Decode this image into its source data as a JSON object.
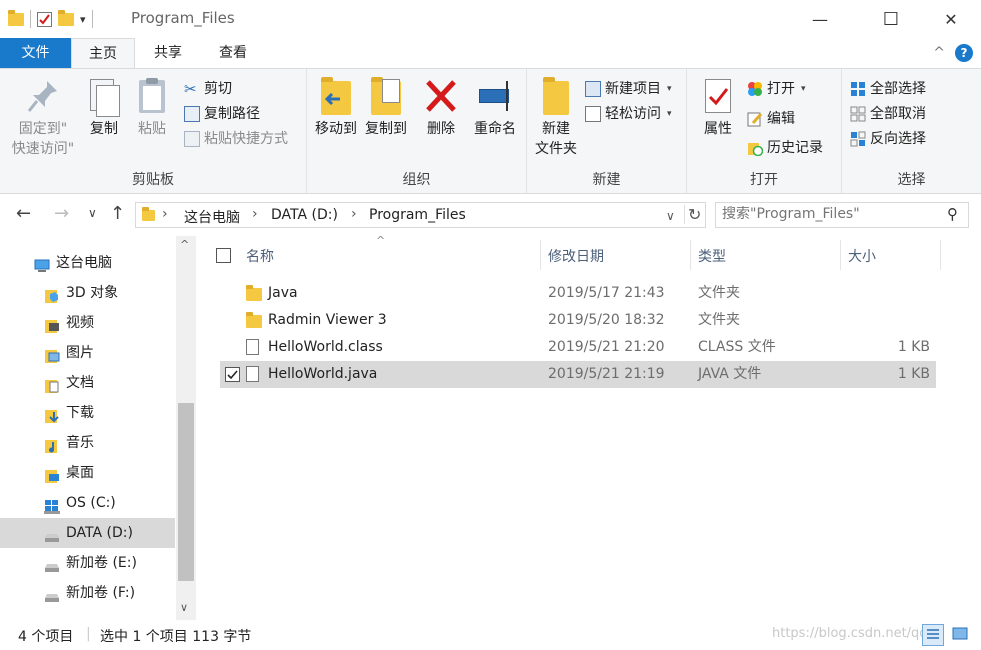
{
  "window": {
    "title": "Program_Files",
    "qat_caret": "▾",
    "minimize": "—",
    "maximize": "☐",
    "close": "✕",
    "collapse_ribbon": "^",
    "help": "?"
  },
  "tabs": [
    {
      "label": "文件"
    },
    {
      "label": "主页"
    },
    {
      "label": "共享"
    },
    {
      "label": "查看"
    }
  ],
  "ribbon": {
    "clipboard": {
      "label": "剪贴板",
      "pin_line1": "固定到\"",
      "pin_line2": "快速访问\"",
      "copy": "复制",
      "paste": "粘贴",
      "cut": "剪切",
      "copy_path": "复制路径",
      "paste_shortcut": "粘贴快捷方式"
    },
    "organize": {
      "label": "组织",
      "move_to": "移动到",
      "copy_to": "复制到",
      "delete": "删除",
      "rename": "重命名"
    },
    "new": {
      "label": "新建",
      "new_folder_line1": "新建",
      "new_folder_line2": "文件夹",
      "new_item": "新建项目",
      "easy_access": "轻松访问"
    },
    "open": {
      "label": "打开",
      "properties": "属性",
      "open": "打开",
      "edit": "编辑",
      "history": "历史记录"
    },
    "select": {
      "label": "选择",
      "select_all": "全部选择",
      "select_none": "全部取消",
      "invert": "反向选择"
    }
  },
  "address": {
    "back": "←",
    "forward": "→",
    "recent": "∨",
    "up": "↑",
    "crumbs": [
      "这台电脑",
      "DATA (D:)",
      "Program_Files"
    ],
    "sep": "›",
    "dropdown": "∨",
    "refresh": "↻"
  },
  "search": {
    "placeholder": "搜索\"Program_Files\"",
    "icon_glyph": "⚲"
  },
  "nav": {
    "items": [
      {
        "label": "这台电脑"
      },
      {
        "label": "3D 对象"
      },
      {
        "label": "视频"
      },
      {
        "label": "图片"
      },
      {
        "label": "文档"
      },
      {
        "label": "下载"
      },
      {
        "label": "音乐"
      },
      {
        "label": "桌面"
      },
      {
        "label": "OS (C:)"
      },
      {
        "label": "DATA (D:)"
      },
      {
        "label": "新加卷 (E:)"
      },
      {
        "label": "新加卷 (F:)"
      }
    ],
    "scroll_up": "^",
    "scroll_down": "∨"
  },
  "columns": {
    "name": "名称",
    "date": "修改日期",
    "type": "类型",
    "size": "大小",
    "sort_arrow": "^"
  },
  "files": [
    {
      "name": "Java",
      "date": "2019/5/17 21:43",
      "type": "文件夹",
      "size": ""
    },
    {
      "name": "Radmin Viewer 3",
      "date": "2019/5/20 18:32",
      "type": "文件夹",
      "size": ""
    },
    {
      "name": "HelloWorld.class",
      "date": "2019/5/21 21:20",
      "type": "CLASS 文件",
      "size": "1 KB"
    },
    {
      "name": "HelloWorld.java",
      "date": "2019/5/21 21:19",
      "type": "JAVA 文件",
      "size": "1 KB"
    }
  ],
  "status": {
    "count": "4 个项目",
    "selection": "选中 1 个项目  113 字节",
    "watermark": "https://blog.csdn.net/qq"
  },
  "colors": {
    "accent": "#1979ca",
    "selected_bg": "#d9d9d9",
    "folder": "#f5c842",
    "delete_red": "#d41a1a"
  }
}
